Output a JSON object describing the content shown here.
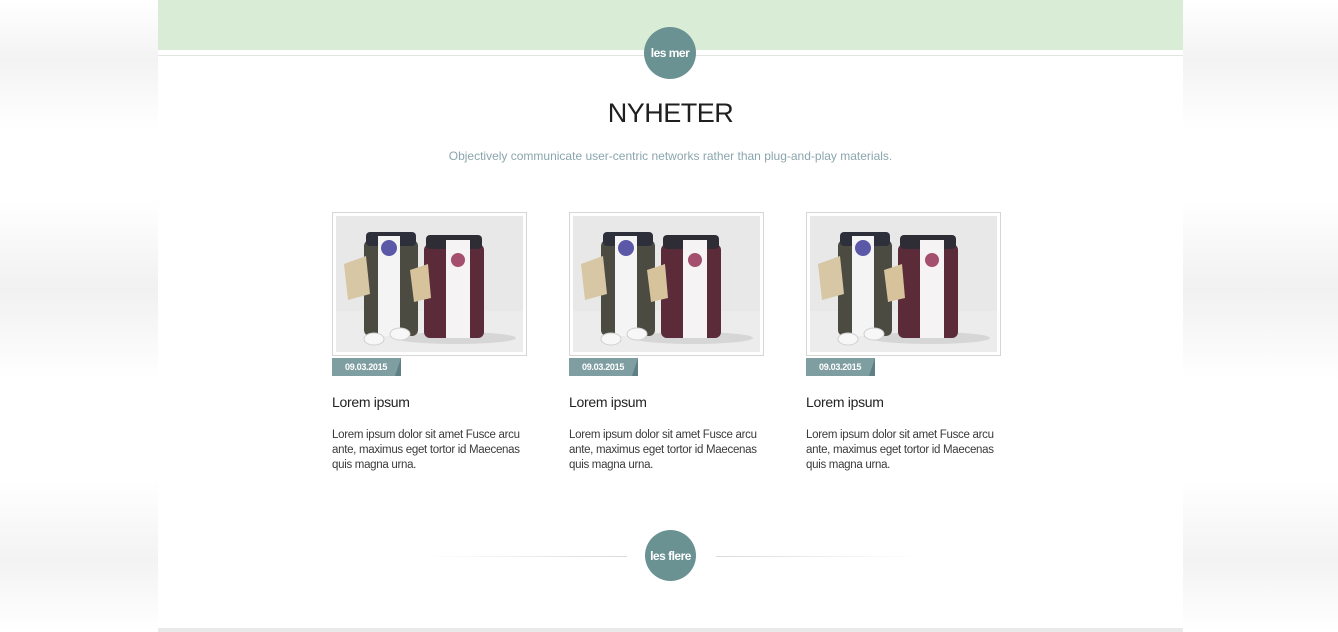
{
  "top_button": {
    "label": "les mer"
  },
  "section": {
    "title": "NYHETER",
    "subtitle": "Objectively communicate user-centric networks rather than plug-and-play materials."
  },
  "news": [
    {
      "date": "09.03.2015",
      "title": "Lorem ipsum",
      "body": "Lorem ipsum dolor sit amet Fusce arcu ante, maximus eget tortor id Maecenas quis magna urna."
    },
    {
      "date": "09.03.2015",
      "title": "Lorem ipsum",
      "body": "Lorem ipsum dolor sit amet Fusce arcu ante, maximus eget tortor id Maecenas quis magna urna."
    },
    {
      "date": "09.03.2015",
      "title": "Lorem ipsum",
      "body": "Lorem ipsum dolor sit amet Fusce arcu ante, maximus eget tortor id Maecenas quis magna urna."
    }
  ],
  "bottom_button": {
    "label": "les flere"
  },
  "colors": {
    "band": "#d8ecd6",
    "accent": "#6a9293",
    "date_tag": "#7f9ea2",
    "subtitle": "#8aa5ad"
  }
}
